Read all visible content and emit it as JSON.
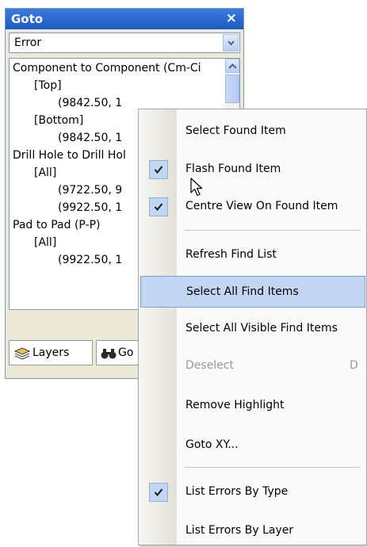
{
  "panel": {
    "title": "Goto",
    "close_glyph": "×",
    "filter_value": "Error",
    "list_rows": [
      {
        "text": "Component to Component  (Cm-Ci",
        "indent": 0
      },
      {
        "text": "[Top]",
        "indent": 1
      },
      {
        "text": "(9842.50,  1",
        "indent": 2
      },
      {
        "text": "[Bottom]",
        "indent": 1
      },
      {
        "text": "(9842.50,  1",
        "indent": 2
      },
      {
        "text": "Drill Hole to Drill Hol",
        "indent": 0
      },
      {
        "text": "[All]",
        "indent": 1
      },
      {
        "text": "(9722.50,  9",
        "indent": 2
      },
      {
        "text": "(9922.50,  1",
        "indent": 2
      },
      {
        "text": "Pad to Pad  (P-P)",
        "indent": 0
      },
      {
        "text": "[All]",
        "indent": 1
      },
      {
        "text": "(9922.50,  1",
        "indent": 2
      }
    ],
    "tabs": [
      {
        "label": "Layers",
        "icon": "layers-icon"
      },
      {
        "label": "Go",
        "icon": "binoculars-icon"
      }
    ]
  },
  "context_menu": {
    "items": [
      {
        "label": "Select Found Item",
        "checked": false,
        "disabled": false,
        "highlight": false,
        "shortcut": ""
      },
      {
        "label": "Flash Found Item",
        "checked": true,
        "disabled": false,
        "highlight": false,
        "shortcut": ""
      },
      {
        "label": "Centre View On Found Item",
        "checked": true,
        "disabled": false,
        "highlight": false,
        "shortcut": ""
      },
      {
        "label": "Refresh Find List",
        "checked": false,
        "disabled": false,
        "highlight": false,
        "shortcut": ""
      },
      {
        "label": "Select All Find Items",
        "checked": false,
        "disabled": false,
        "highlight": true,
        "shortcut": ""
      },
      {
        "label": "Select All Visible Find Items",
        "checked": false,
        "disabled": false,
        "highlight": false,
        "shortcut": ""
      },
      {
        "label": "Deselect",
        "checked": false,
        "disabled": true,
        "highlight": false,
        "shortcut": "D"
      },
      {
        "label": "Remove Highlight",
        "checked": false,
        "disabled": false,
        "highlight": false,
        "shortcut": ""
      },
      {
        "label": "Goto XY...",
        "checked": false,
        "disabled": false,
        "highlight": false,
        "shortcut": ""
      },
      {
        "label": "List Errors By Type",
        "checked": true,
        "disabled": false,
        "highlight": false,
        "shortcut": ""
      },
      {
        "label": "List Errors By Layer",
        "checked": false,
        "disabled": false,
        "highlight": false,
        "shortcut": ""
      }
    ]
  },
  "colors": {
    "title_bar": "#2563cf",
    "highlight": "#c2d5f2",
    "disabled_text": "#9a9a9a"
  },
  "icons": {
    "checkmark": "checkmark-icon",
    "cursor": "mouse-pointer-icon"
  }
}
